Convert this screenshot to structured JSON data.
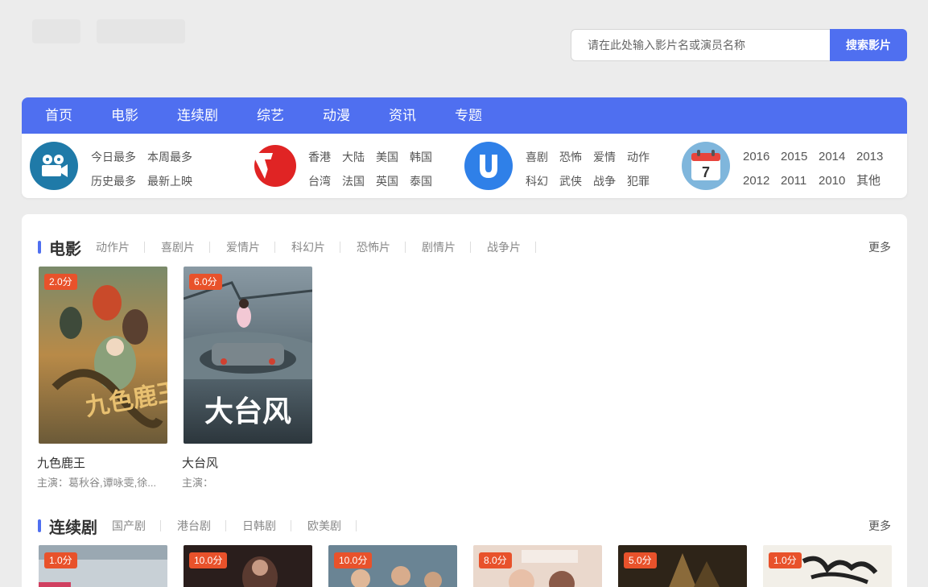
{
  "search": {
    "placeholder": "请在此处输入影片名或演员名称",
    "button": "搜索影片"
  },
  "nav": [
    "首页",
    "电影",
    "连续剧",
    "综艺",
    "动漫",
    "资讯",
    "专题"
  ],
  "categories": {
    "group1": [
      "今日最多",
      "本周最多",
      "历史最多",
      "最新上映"
    ],
    "group2": [
      "香港",
      "大陆",
      "美国",
      "韩国",
      "台湾",
      "法国",
      "英国",
      "泰国"
    ],
    "group3": [
      "喜剧",
      "恐怖",
      "爱情",
      "动作",
      "科幻",
      "武侠",
      "战争",
      "犯罪"
    ],
    "group4": [
      "2016",
      "2015",
      "2014",
      "2013",
      "2012",
      "2011",
      "2010",
      "其他"
    ],
    "calendar_day": "7"
  },
  "movies": {
    "title": "电影",
    "tags": [
      "动作片",
      "喜剧片",
      "爱情片",
      "科幻片",
      "恐怖片",
      "剧情片",
      "战争片"
    ],
    "more": "更多",
    "items": [
      {
        "score": "2.0分",
        "title": "九色鹿王",
        "actors": "主演：葛秋谷,谭咏雯,徐...",
        "poster_text": "九色鹿王"
      },
      {
        "score": "6.0分",
        "title": "大台风",
        "actors": "主演：",
        "poster_text": "大台风"
      }
    ]
  },
  "series": {
    "title": "连续剧",
    "tags": [
      "国产剧",
      "港台剧",
      "日韩剧",
      "欧美剧"
    ],
    "more": "更多",
    "items": [
      {
        "score": "1.0分"
      },
      {
        "score": "10.0分"
      },
      {
        "score": "10.0分"
      },
      {
        "score": "8.0分"
      },
      {
        "score": "5.0分"
      },
      {
        "score": "1.0分"
      }
    ]
  },
  "colors": {
    "accent": "#4f6ff0",
    "score_badge": "#e8522b"
  }
}
